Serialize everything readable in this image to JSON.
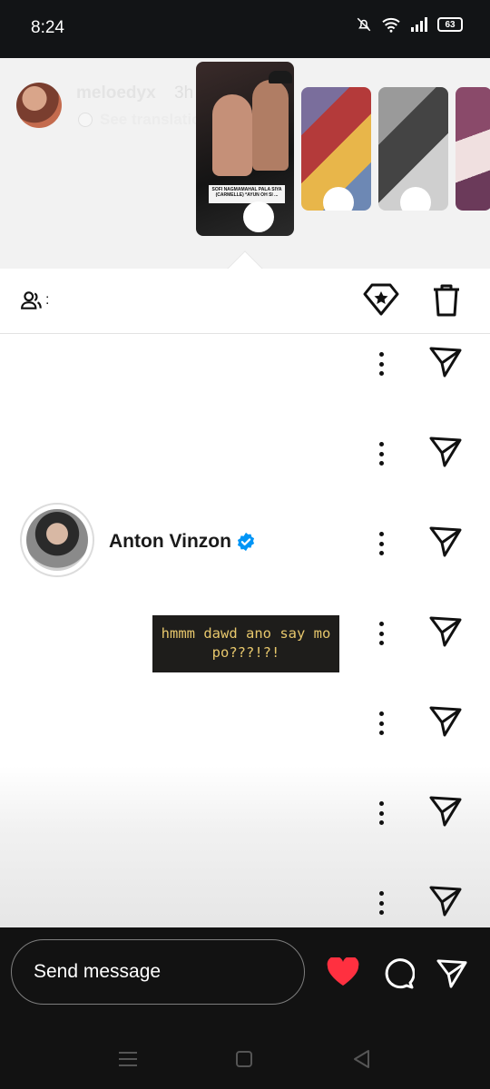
{
  "status_bar": {
    "time": "8:24",
    "battery": "63",
    "icons": [
      "mute-bell-icon",
      "wifi-icon",
      "signal-icon",
      "battery-icon"
    ]
  },
  "story": {
    "username": "meloedyx",
    "time_ago": "3h",
    "see_translation": "See translation",
    "thumbnail_banner": "SOFI NAGMAMAHAL PALA SIYA (CARMELLE) *AYUN OH SI ..."
  },
  "actions": {
    "viewers_icon": "viewers-icon",
    "viewers_count": ":",
    "highlight_icon": "highlight-diamond-icon",
    "delete_icon": "trash-icon"
  },
  "viewers": [
    {
      "name": "Anton Vinzon",
      "verified": true
    }
  ],
  "reply_sticker": {
    "text": "hmmm dawd ano say mo po???!?!"
  },
  "bottom_bar": {
    "placeholder": "Send message",
    "like_icon": "heart-icon",
    "comment_icon": "comment-icon",
    "share_icon": "send-icon"
  },
  "colors": {
    "heart": "#ff3040",
    "verified": "#0095f6",
    "sticker_bg": "#1e1d1b",
    "sticker_text": "#e7c76c"
  }
}
